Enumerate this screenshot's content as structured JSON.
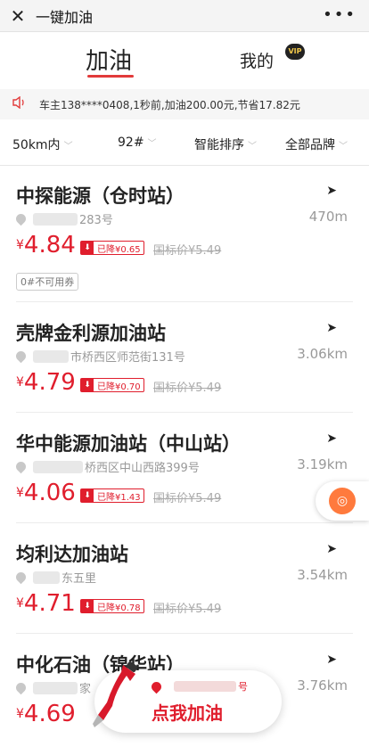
{
  "topbar": {
    "close_icon": "close-icon",
    "title": "一键加油",
    "more_icon": "more-icon"
  },
  "tabs": {
    "active": "加油",
    "mine": "我的",
    "vip": "VIP"
  },
  "notice": {
    "icon": "speaker-icon",
    "text": "车主138****0408,1秒前,加油200.00元,节省17.82元"
  },
  "filters": [
    {
      "label": "50km内"
    },
    {
      "label": "92#"
    },
    {
      "label": "智能排序"
    },
    {
      "label": "全部品牌"
    }
  ],
  "stations": [
    {
      "name": "中探能源（仓时站）",
      "distance": "470m",
      "address": "283号",
      "yen": "¥",
      "price": "4.84",
      "drop": "已降¥0.65",
      "std": "国标价¥5.49",
      "coupon": "0#不可用券"
    },
    {
      "name": "壳牌金利源加油站",
      "distance": "3.06km",
      "address": "市桥西区师范街131号",
      "yen": "¥",
      "price": "4.79",
      "drop": "已降¥0.70",
      "std": "国标价¥5.49"
    },
    {
      "name": "华中能源加油站（中山站）",
      "distance": "3.19km",
      "address": "桥西区中山西路399号",
      "yen": "¥",
      "price": "4.06",
      "drop": "已降¥1.43",
      "std": "国标价¥5.49"
    },
    {
      "name": "均利达加油站",
      "distance": "3.54km",
      "address": "东五里",
      "yen": "¥",
      "price": "4.71",
      "drop": "已降¥0.78",
      "std": "国标价¥5.49"
    },
    {
      "name": "中化石油（锦华站）",
      "distance": "3.76km",
      "address": "家",
      "yen": "¥",
      "price": "4.69"
    }
  ],
  "cta": {
    "suffix": "号",
    "label": "点我加油"
  },
  "colors": {
    "accent": "#e01e2d",
    "muted": "#999999"
  }
}
